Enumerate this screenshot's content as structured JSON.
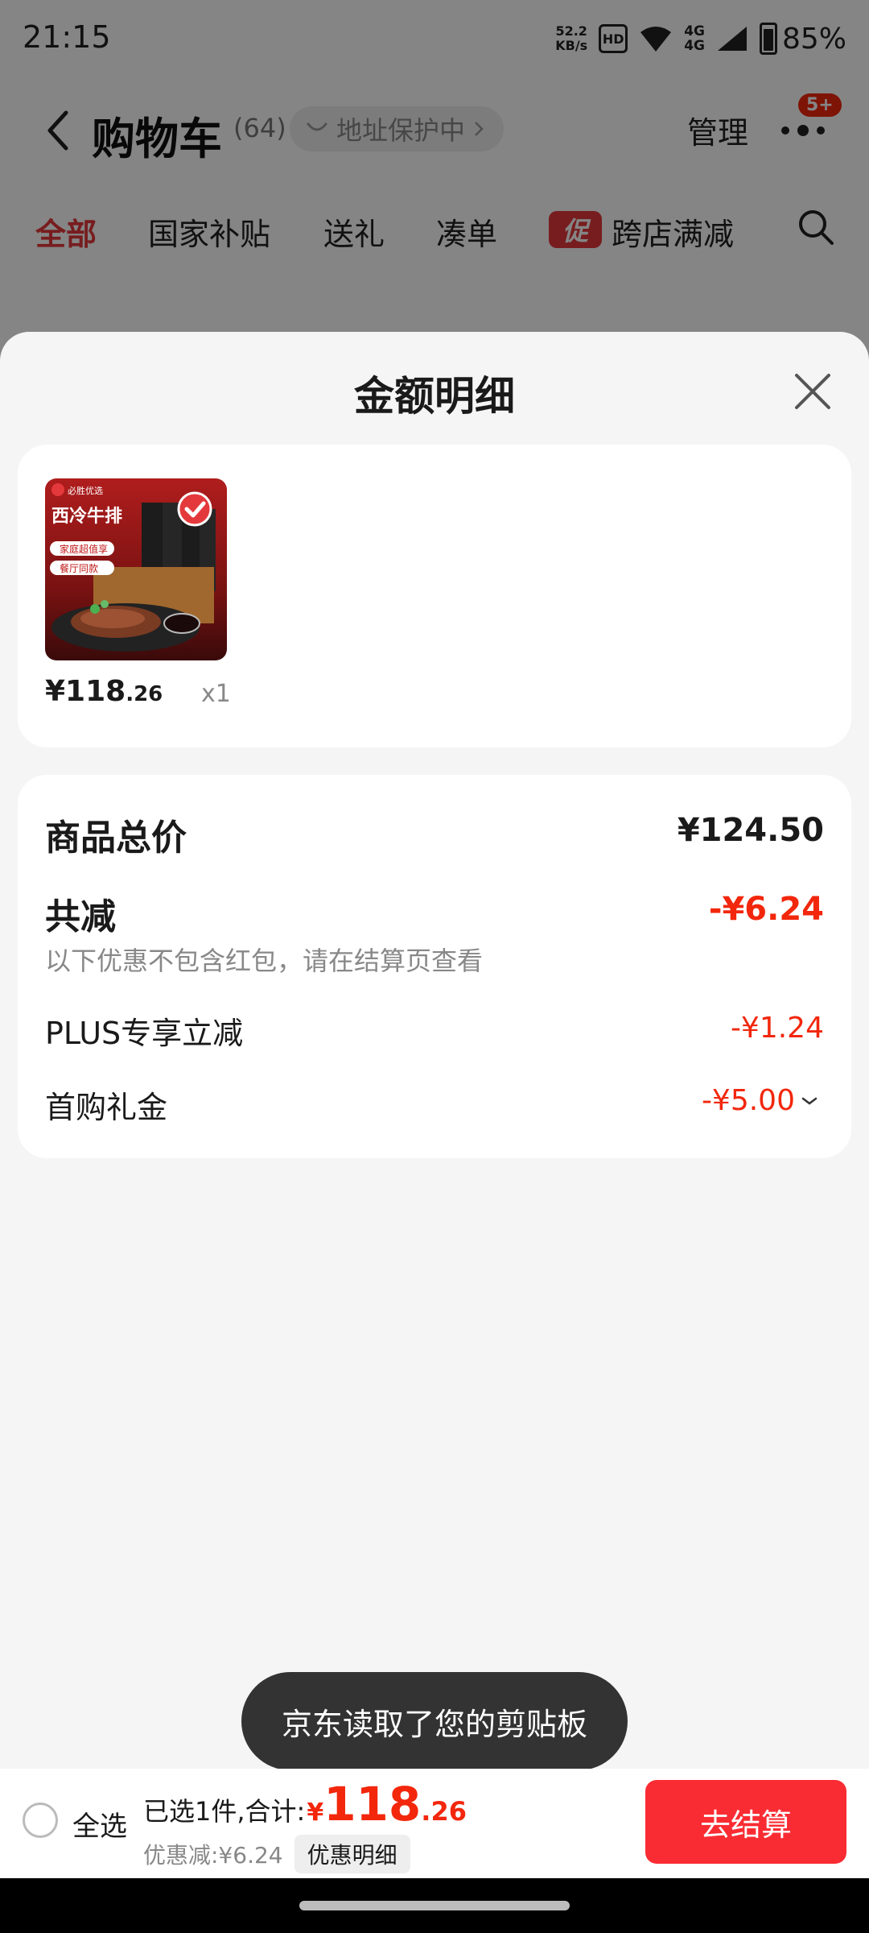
{
  "status_bar": {
    "time": "21:15",
    "net_speed_value": "52.2",
    "net_speed_unit": "KB/s",
    "hd_label": "HD",
    "wifi_icon": "wifi-icon",
    "cell_label_top": "4G",
    "cell_label_bottom": "4G",
    "battery": "85%"
  },
  "header": {
    "title": "购物车",
    "count": "(64)",
    "address_protect": "地址保护中",
    "manage": "管理",
    "more_badge": "5+"
  },
  "tabs": {
    "all": "全部",
    "subsidy": "国家补贴",
    "gift": "送礼",
    "bundle": "凑单",
    "promo_tag": "促",
    "cross_store": "跨店满减"
  },
  "sheet": {
    "title": "金额明细",
    "product": {
      "image_brand": "必胜优选",
      "image_title": "西冷牛排",
      "image_tags": [
        "家庭超值享",
        "餐厅同款"
      ],
      "price_main": "¥118",
      "price_cents": ".26",
      "qty": "x1"
    },
    "summary": {
      "total_label": "商品总价",
      "total_value": "¥124.50",
      "reduce_label": "共减",
      "reduce_value": "-¥6.24",
      "reduce_note": "以下优惠不包含红包，请在结算页查看",
      "plus_label": "PLUS专享立减",
      "plus_value": "-¥1.24",
      "first_label": "首购礼金",
      "first_value": "-¥5.00"
    }
  },
  "toast": "京东读取了您的剪贴板",
  "bottom_bar": {
    "select_all": "全选",
    "selected_text": "已选1件,合计:",
    "yen": "¥",
    "total_int": "118",
    "total_cents": ".26",
    "discount": "优惠减:¥6.24",
    "detail_button": "优惠明细",
    "checkout": "去结算"
  },
  "colors": {
    "accent_red": "#f2270c",
    "checkout_red": "#fa2c33",
    "sheet_bg": "#f5f5f5"
  }
}
